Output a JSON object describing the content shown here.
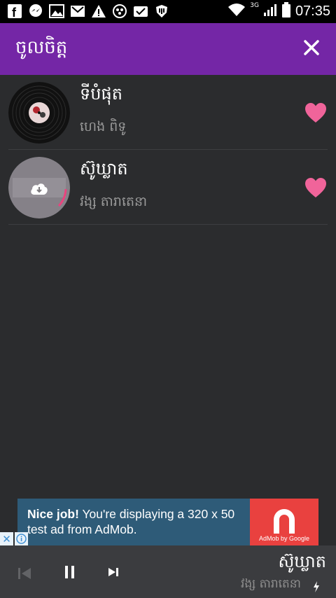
{
  "status_bar": {
    "icons": [
      "facebook-icon",
      "messenger-icon",
      "gallery-icon",
      "gmail-icon",
      "warning-icon",
      "media-icon",
      "mail-check-icon",
      "shield-app-icon"
    ],
    "network": "3G",
    "time": "07:35"
  },
  "app_bar": {
    "title": "ចូលចិត្ត",
    "close_icon": "close-icon"
  },
  "songs": [
    {
      "title": "ទីបំផុត",
      "artist": "ហេង ពិទូ",
      "favorite": true
    },
    {
      "title": "ស៊ូឃ្លាត",
      "artist": "វង្ស តារាតេនា",
      "favorite": true,
      "downloading": true
    }
  ],
  "ad": {
    "headline": "Nice job!",
    "body": "You're displaying a 320 x 50 test ad from AdMob.",
    "logo_label": "AdMob by Google"
  },
  "player": {
    "title": "ស៊ូឃ្លាត",
    "artist": "វង្ស តារាតេនា"
  },
  "colors": {
    "accent": "#7426a6",
    "heart": "#f0649a",
    "background": "#2b2c2e"
  }
}
